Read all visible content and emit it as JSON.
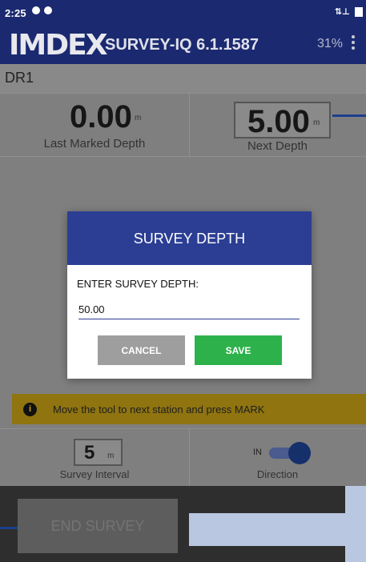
{
  "status_bar": {
    "time": "2:25",
    "network_label": "⇅⊥"
  },
  "app_bar": {
    "logo": "IMDEX",
    "version": "SURVEY-IQ 6.1.1587",
    "battery": "31%"
  },
  "drill_run": "DR1",
  "depths": {
    "last_marked_value": "0.00",
    "last_marked_unit": "m",
    "last_marked_label": "Last Marked Depth",
    "next_value": "5.00",
    "next_unit": "m",
    "next_label": "Next Depth"
  },
  "dialog": {
    "title": "SURVEY DEPTH",
    "prompt": "ENTER SURVEY DEPTH:",
    "input_value": "50.00",
    "cancel_label": "CANCEL",
    "save_label": "SAVE"
  },
  "warning": {
    "icon_glyph": "i",
    "message": "Move the tool to next station and press MARK"
  },
  "interval": {
    "value": "5",
    "unit": "m",
    "label": "Survey Interval"
  },
  "direction": {
    "state_label": "IN",
    "label": "Direction",
    "enabled": true
  },
  "footer": {
    "end_survey_label": "END SURVEY"
  },
  "colors": {
    "app_bar": "#1b2a70",
    "dialog_header": "#2b3e94",
    "save_button": "#2db24b",
    "cancel_button": "#9e9e9e",
    "warning": "#c9a415",
    "arrow": "#b9c7e0"
  }
}
